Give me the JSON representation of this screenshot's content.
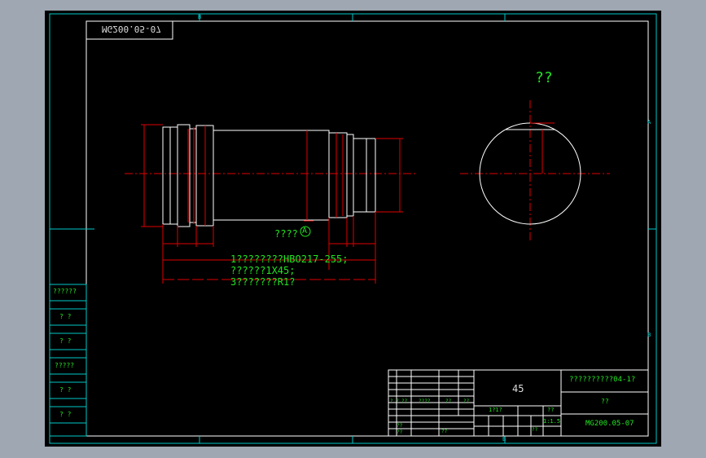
{
  "drawing": {
    "mirrored_number": "MG200.05-07",
    "section_title": "??",
    "datum_marker": "????",
    "datum_letter": "A",
    "notes": [
      "1????????HBO217-255;",
      "??????1X45;",
      "3???????R1?"
    ],
    "zone_letters": {
      "top_b": "B",
      "right_a": "A",
      "right_b": "B",
      "bottom_b": "B"
    }
  },
  "left_table": {
    "rows": [
      "??????",
      "? ?",
      "? ?",
      "?????",
      "? ?",
      "? ?"
    ]
  },
  "title_block": {
    "material": "45",
    "part_name": "??????????04-1?",
    "unit_label": "??",
    "drawing_number": "MG200.05-07",
    "scale_header": "1?1?",
    "scale_header2": "??",
    "scale_value": "1:1.5",
    "revision_headers": [
      "? ?",
      "??",
      "????",
      "??",
      "??"
    ],
    "small_labels": {
      "r1": "??",
      "r2": "??",
      "r3": "??",
      "r4": "??"
    }
  },
  "colors": {
    "frame": "#00c8c8",
    "dimension": "#e00000",
    "text": "#22e322",
    "outline": "#ffffff"
  }
}
